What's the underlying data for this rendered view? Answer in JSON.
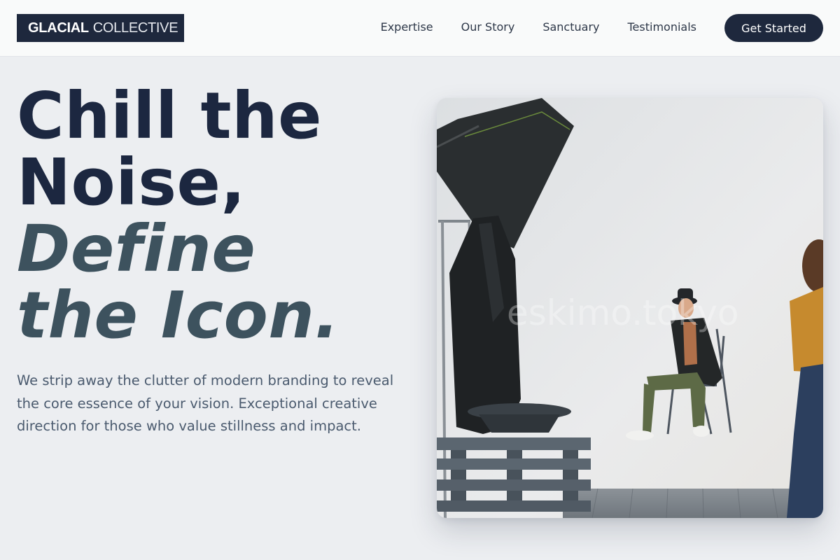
{
  "header": {
    "logo_bold": "GLACIAL",
    "logo_light": "COLLECTIVE",
    "nav": [
      "Expertise",
      "Our Story",
      "Sanctuary",
      "Testimonials"
    ],
    "cta_label": "Get Started"
  },
  "hero": {
    "title_lines": [
      "Chill the",
      "Noise,"
    ],
    "accent_lines": [
      "Define",
      "the Icon."
    ],
    "description": "We strip away the clutter of modern branding to reveal the core essence of your vision. Exceptional creative direction for those who value stillness and impact.",
    "image_watermark": "eskimo.tokyo"
  },
  "colors": {
    "navy": "#1e283d",
    "accent_slate": "#3d525e",
    "background": "#eceef1"
  }
}
